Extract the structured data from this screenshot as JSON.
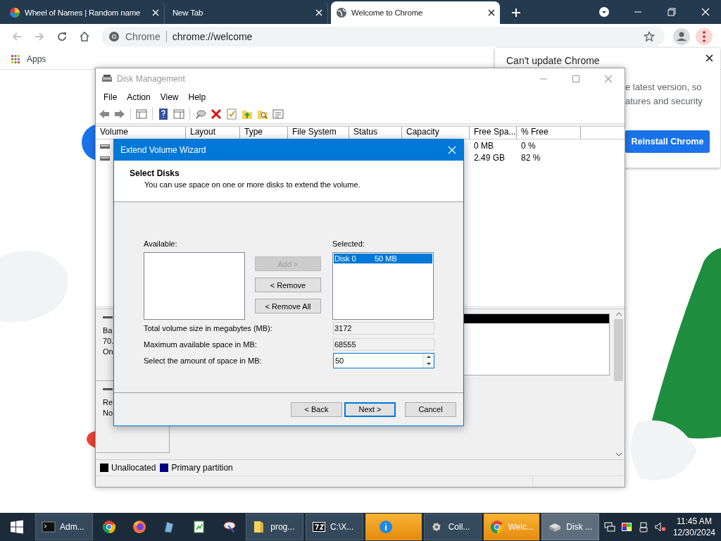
{
  "browser": {
    "tabs": [
      {
        "title": "Wheel of Names | Random name",
        "selected": false
      },
      {
        "title": "New Tab",
        "selected": false
      },
      {
        "title": "Welcome to Chrome",
        "selected": true
      }
    ],
    "address": {
      "site": "Chrome",
      "url": "chrome://welcome"
    },
    "bookmarks": [
      "Apps"
    ]
  },
  "update_popup": {
    "title": "Can't update Chrome",
    "lines": [
      "e latest version, so",
      "atures and security"
    ],
    "button": "Reinstall Chrome"
  },
  "disk_management": {
    "title": "Disk Management",
    "menu": [
      "File",
      "Action",
      "View",
      "Help"
    ],
    "columns": [
      "Volume",
      "Layout",
      "Type",
      "File System",
      "Status",
      "Capacity",
      "Free Spa...",
      "% Free"
    ],
    "rows": [
      {
        "free_space": "0 MB",
        "percent_free": "0 %"
      },
      {
        "free_space": "2.49 GB",
        "percent_free": "82 %"
      }
    ],
    "disks": [
      {
        "lines": [
          "Ba",
          "70.",
          "On"
        ],
        "kind": "unallocated"
      },
      {
        "lines": [
          "Re",
          "No"
        ],
        "kind": "empty"
      }
    ],
    "legend": [
      {
        "label": "Unallocated",
        "color": "#000000"
      },
      {
        "label": "Primary partition",
        "color": "#000080"
      }
    ]
  },
  "wizard": {
    "title": "Extend Volume Wizard",
    "heading": "Select Disks",
    "subtitle": "You can use space on one or more disks to extend the volume.",
    "available_label": "Available:",
    "actions": [
      {
        "label": "Add >",
        "disabled": true
      },
      {
        "label": "< Remove",
        "disabled": false
      },
      {
        "label": "< Remove All",
        "disabled": false
      }
    ],
    "selected_label": "Selected:",
    "selected_items": [
      {
        "disk": "Disk 0",
        "size": "50 MB",
        "selected": true
      }
    ],
    "fields": [
      {
        "label": "Total volume size in megabytes (MB):",
        "value": "3172",
        "kind": "readonly"
      },
      {
        "label": "Maximum available space in MB:",
        "value": "68555",
        "kind": "readonly"
      },
      {
        "label": "Select the amount of space in MB:",
        "value": "50",
        "kind": "spinner"
      }
    ],
    "buttons": [
      {
        "label": "< Back",
        "default": false
      },
      {
        "label": "Next >",
        "default": true
      },
      {
        "label": "Cancel",
        "default": false
      }
    ]
  },
  "taskbar": {
    "items": [
      {
        "label": "Adm...",
        "flashing": false,
        "active": false
      },
      {
        "flashing": false,
        "active": false
      },
      {
        "flashing": false,
        "active": false
      },
      {
        "flashing": false,
        "active": false
      },
      {
        "flashing": false,
        "active": false
      },
      {
        "flashing": false,
        "active": false
      },
      {
        "label": "prog...",
        "flashing": false,
        "active": false
      },
      {
        "label": "C:\\X...",
        "flashing": false,
        "active": false
      },
      {
        "flashing": true,
        "active": false
      },
      {
        "label": "Coll...",
        "flashing": false,
        "active": false
      },
      {
        "label": "Welc...",
        "flashing": true,
        "active": false
      },
      {
        "label": "Disk ...",
        "flashing": false,
        "active": true
      }
    ],
    "time": "11:45 AM",
    "date": "12/30/2024"
  }
}
